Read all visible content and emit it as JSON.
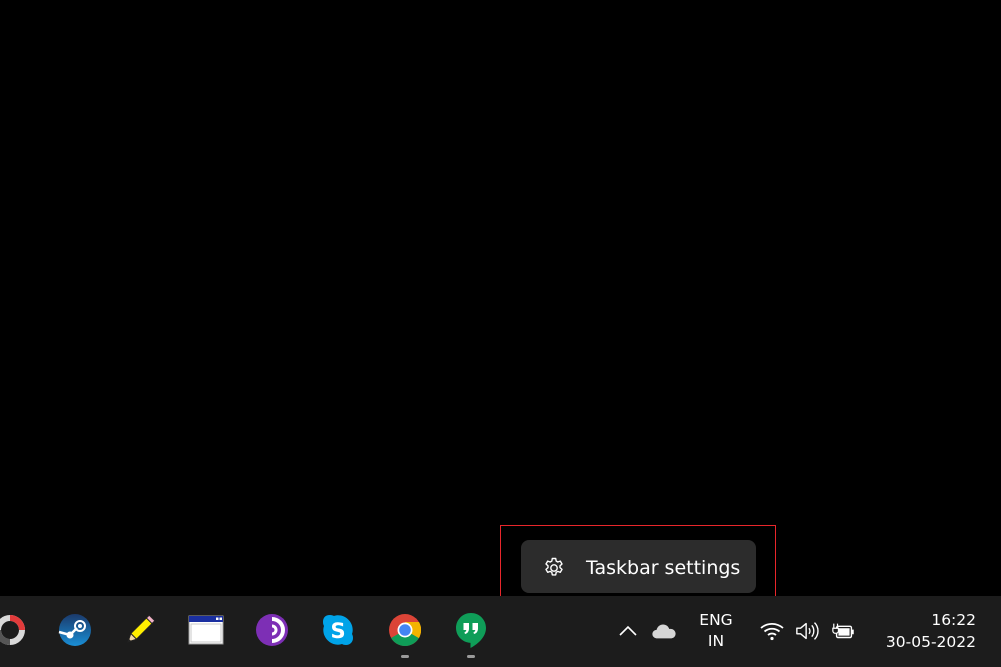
{
  "context_menu": {
    "items": [
      {
        "label": "Taskbar settings",
        "icon": "gear-icon"
      }
    ]
  },
  "taskbar": {
    "apps": [
      {
        "name": "app-circle",
        "icon": "ring-icon",
        "running": false
      },
      {
        "name": "steam",
        "icon": "steam-icon",
        "running": false
      },
      {
        "name": "pencil-app",
        "icon": "pencil-icon",
        "running": false
      },
      {
        "name": "window-app",
        "icon": "window-icon",
        "running": false
      },
      {
        "name": "tor-browser",
        "icon": "tor-icon",
        "running": false
      },
      {
        "name": "skype",
        "icon": "skype-icon",
        "running": false
      },
      {
        "name": "chrome",
        "icon": "chrome-icon",
        "running": true
      },
      {
        "name": "hangouts",
        "icon": "hangouts-icon",
        "running": true
      }
    ],
    "tray": {
      "icons": [
        "chevron-up-icon",
        "cloud-icon",
        "wifi-icon",
        "volume-icon",
        "battery-charging-icon"
      ],
      "language": {
        "line1": "ENG",
        "line2": "IN"
      },
      "clock": {
        "time": "16:22",
        "date": "30-05-2022"
      }
    }
  },
  "colors": {
    "desktop": "#000000",
    "taskbar": "#1c1c1c",
    "menu": "#2c2c2c",
    "highlight": "#e8262b"
  }
}
